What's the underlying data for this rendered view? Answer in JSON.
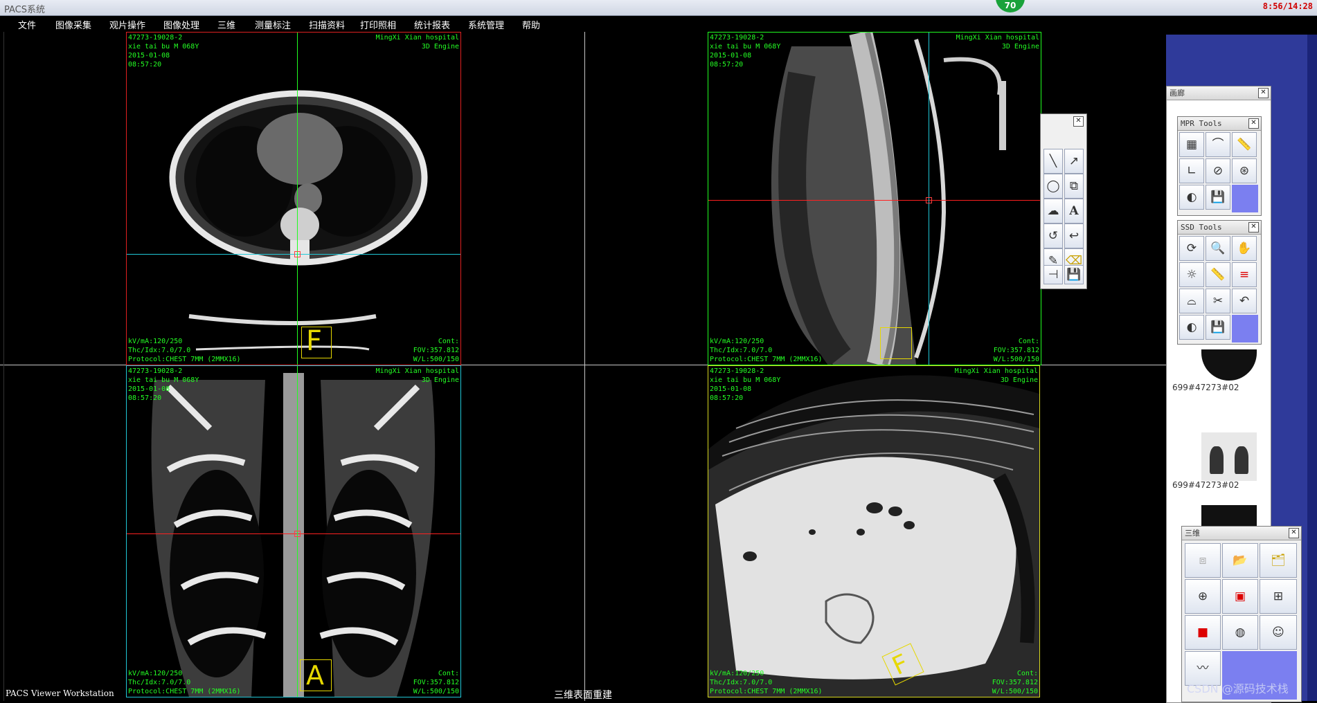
{
  "app_title": "PACS系统",
  "clock": "8:56/14:28",
  "notify_count": "70",
  "menu": [
    "文件",
    "图像采集",
    "观片操作",
    "图像处理",
    "三维",
    "测量标注",
    "扫描资料",
    "打印照相",
    "统计报表",
    "系统管理",
    "帮助"
  ],
  "viewports": [
    {
      "name": "axial",
      "study_id": "47273-19028-2",
      "patient": "xie tai bu M 068Y",
      "date": "2015-01-08",
      "time": "08:57:20",
      "hospital": "MingXi Xian hospital",
      "engine": "3D Engine",
      "kv": "kV/mA:120/250",
      "thc": "Thc/Idx:7.0/7.0",
      "protocol": "Protocol:CHEST 7MM (2MMX16)",
      "cont": "Cont:",
      "fov": "FOV:357.812",
      "wl": "W/L:500/150",
      "orientation": "F"
    },
    {
      "name": "sagittal",
      "study_id": "47273-19028-2",
      "patient": "xie tai bu M 068Y",
      "date": "2015-01-08",
      "time": "08:57:20",
      "hospital": "MingXi Xian hospital",
      "engine": "3D Engine",
      "kv": "kV/mA:120/250",
      "thc": "Thc/Idx:7.0/7.0",
      "protocol": "Protocol:CHEST 7MM (2MMX16)",
      "cont": "Cont:",
      "fov": "FOV:357.812",
      "wl": "W/L:500/150",
      "orientation": ""
    },
    {
      "name": "coronal",
      "study_id": "47273-19028-2",
      "patient": "xie tai bu M 068Y",
      "date": "2015-01-08",
      "time": "08:57:20",
      "hospital": "MingXi Xian hospital",
      "engine": "3D Engine",
      "kv": "kV/mA:120/250",
      "thc": "Thc/Idx:7.0/7.0",
      "protocol": "Protocol:CHEST 7MM (2MMX16)",
      "cont": "Cont:",
      "fov": "FOV:357.812",
      "wl": "W/L:500/150",
      "orientation": "A"
    },
    {
      "name": "surface-3d",
      "study_id": "47273-19028-2",
      "patient": "xie tai bu M 068Y",
      "date": "2015-01-08",
      "time": "08:57:20",
      "hospital": "MingXi Xian hospital",
      "engine": "3D Engine",
      "kv": "kV/mA:120/250",
      "thc": "Thc/Idx:7.0/7.0",
      "protocol": "Protocol:CHEST 7MM (2MMX16)",
      "cont": "Cont:",
      "fov": "FOV:357.812",
      "wl": "W/L:500/150",
      "orientation": "F"
    }
  ],
  "footer_left": "PACS Viewer Workstation",
  "footer_center": "三维表面重建",
  "gallery": {
    "title": "画廊",
    "items": [
      "699#47273#02",
      "699#47273#02"
    ]
  },
  "mpr_tools": {
    "title": "MPR Tools"
  },
  "ssd_tools": {
    "title": "SSD Tools"
  },
  "three_d_panel": {
    "title": "三维"
  },
  "watermark": "CSDN @源码技术栈",
  "colors": {
    "overlay_text": "#24ff24",
    "crosshair_red": "#ff2020",
    "crosshair_green": "#20ff20",
    "crosshair_cyan": "#20c8d8",
    "accent_panel": "#7b7ff0"
  }
}
